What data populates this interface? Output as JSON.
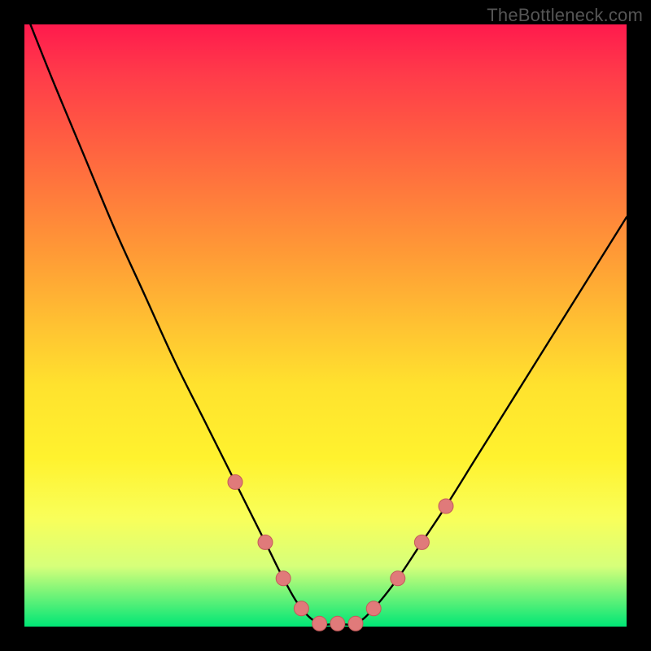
{
  "watermark": "TheBottleneck.com",
  "colors": {
    "bead_fill": "#e07a7a",
    "bead_stroke": "#c45a5a",
    "curve_stroke": "#000000",
    "frame_bg": "#000000"
  },
  "chart_data": {
    "type": "line",
    "title": "",
    "xlabel": "",
    "ylabel": "",
    "xlim": [
      0,
      100
    ],
    "ylim": [
      0,
      100
    ],
    "grid": false,
    "legend": false,
    "series": [
      {
        "name": "curve",
        "x": [
          1,
          5,
          10,
          15,
          20,
          25,
          30,
          35,
          40,
          43,
          46,
          49,
          52,
          55,
          58,
          62,
          66,
          70,
          75,
          80,
          85,
          90,
          95,
          100
        ],
        "y": [
          100,
          90,
          78,
          66,
          55,
          44,
          34,
          24,
          14,
          8,
          3,
          0.5,
          0.5,
          0.5,
          3,
          8,
          14,
          20,
          28,
          36,
          44,
          52,
          60,
          68
        ]
      }
    ],
    "markers": [
      {
        "x_index": 7,
        "side": "left"
      },
      {
        "x_index": 8,
        "side": "left"
      },
      {
        "x_index": 9,
        "side": "left"
      },
      {
        "x_index": 10,
        "side": "left"
      },
      {
        "x_index": 11,
        "side": "bottom"
      },
      {
        "x_index": 12,
        "side": "bottom"
      },
      {
        "x_index": 13,
        "side": "bottom"
      },
      {
        "x_index": 14,
        "side": "right"
      },
      {
        "x_index": 15,
        "side": "right"
      },
      {
        "x_index": 16,
        "side": "right"
      },
      {
        "x_index": 17,
        "side": "right"
      }
    ],
    "bead_radius": 9
  }
}
